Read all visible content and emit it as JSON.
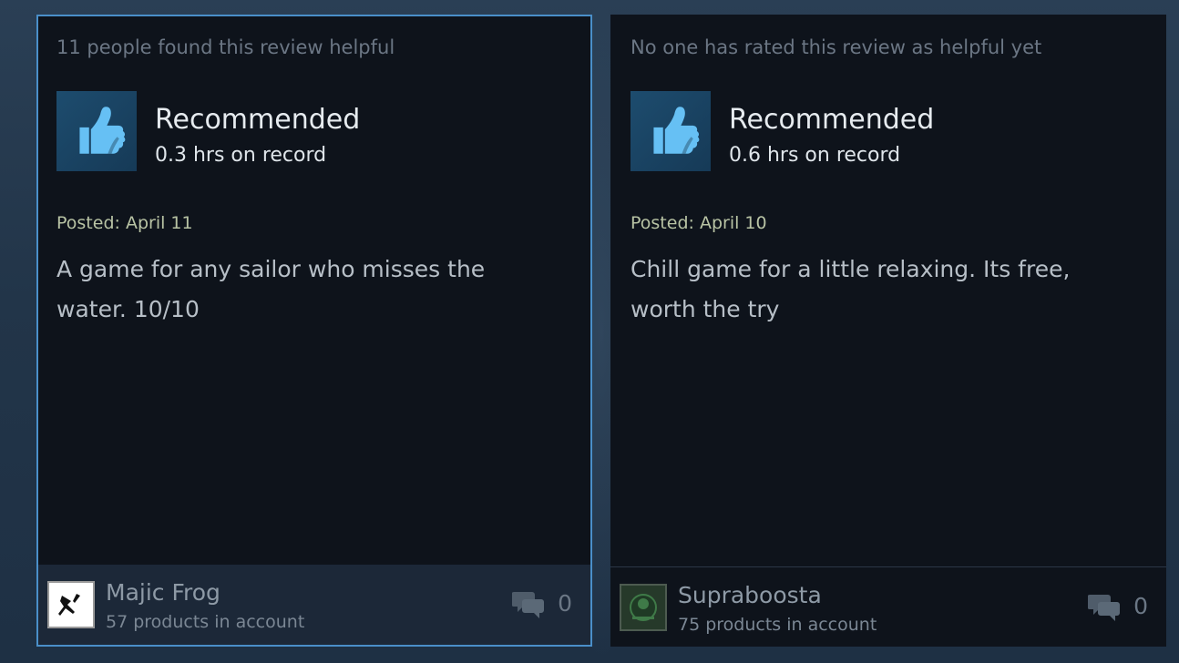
{
  "reviews": [
    {
      "helpful_text": "11 people found this review helpful",
      "verdict": "Recommended",
      "hours": "0.3 hrs on record",
      "posted": "Posted: April 11",
      "text": "A game for any sailor who misses the water. 10/10",
      "author": "Majic Frog",
      "products": "57 products in account",
      "comments": "0",
      "selected": true,
      "thumb_icon": "thumbs-up-icon",
      "comment_icon": "comments-icon"
    },
    {
      "helpful_text": "No one has rated this review as helpful yet",
      "verdict": "Recommended",
      "hours": "0.6 hrs on record",
      "posted": "Posted: April 10",
      "text": "Chill game for a little relaxing. Its free, worth the try",
      "author": "Supraboosta",
      "products": "75 products in account",
      "comments": "0",
      "selected": false,
      "thumb_icon": "thumbs-up-icon",
      "comment_icon": "comments-icon"
    }
  ],
  "colors": {
    "accent_border": "#4a8fc9",
    "card_bg": "#0e131b",
    "thumb_bg": "#1d4c6e",
    "thumb_icon": "#66c0f4"
  }
}
